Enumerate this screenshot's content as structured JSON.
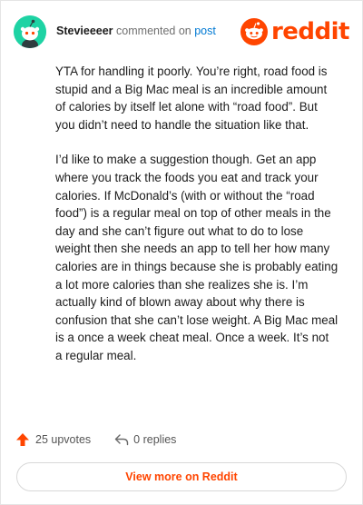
{
  "comment": {
    "author": "Stevieeeer",
    "action_text": "commented on",
    "post_link": "post",
    "paragraphs": [
      "YTA for handling it poorly. You’re right, road food is stupid and a Big Mac meal is an incredible amount of calories by itself let alone with “road food”. But you didn’t need to handle the situation like that.",
      "I’d like to make a suggestion though. Get an app where you track the foods you eat and track your calories. If McDonald’s (with or without the “road food”) is a regular meal on top of other meals in the day and she can’t figure out what to do to lose weight then she needs an app to tell her how many calories are in things because she is probably eating a lot more calories than she realizes she is. I’m actually kind of blown away about why there is confusion that she can’t lose weight. A Big Mac meal is a once a week cheat meal. Once a week. It’s not a regular meal."
    ]
  },
  "brand": {
    "name": "reddit",
    "color": "#ff4500"
  },
  "stats": {
    "upvotes": "25 upvotes",
    "replies": "0 replies"
  },
  "cta": {
    "label": "View more on Reddit"
  },
  "colors": {
    "avatar_bg": "#1ed3a4",
    "link": "#0079d3",
    "upvote_arrow": "#ff4500"
  },
  "icons": {
    "avatar": "snoo-avatar-icon",
    "logo": "reddit-snoo-logo-icon",
    "upvote": "upvote-arrow-icon",
    "reply": "reply-arrow-icon"
  }
}
